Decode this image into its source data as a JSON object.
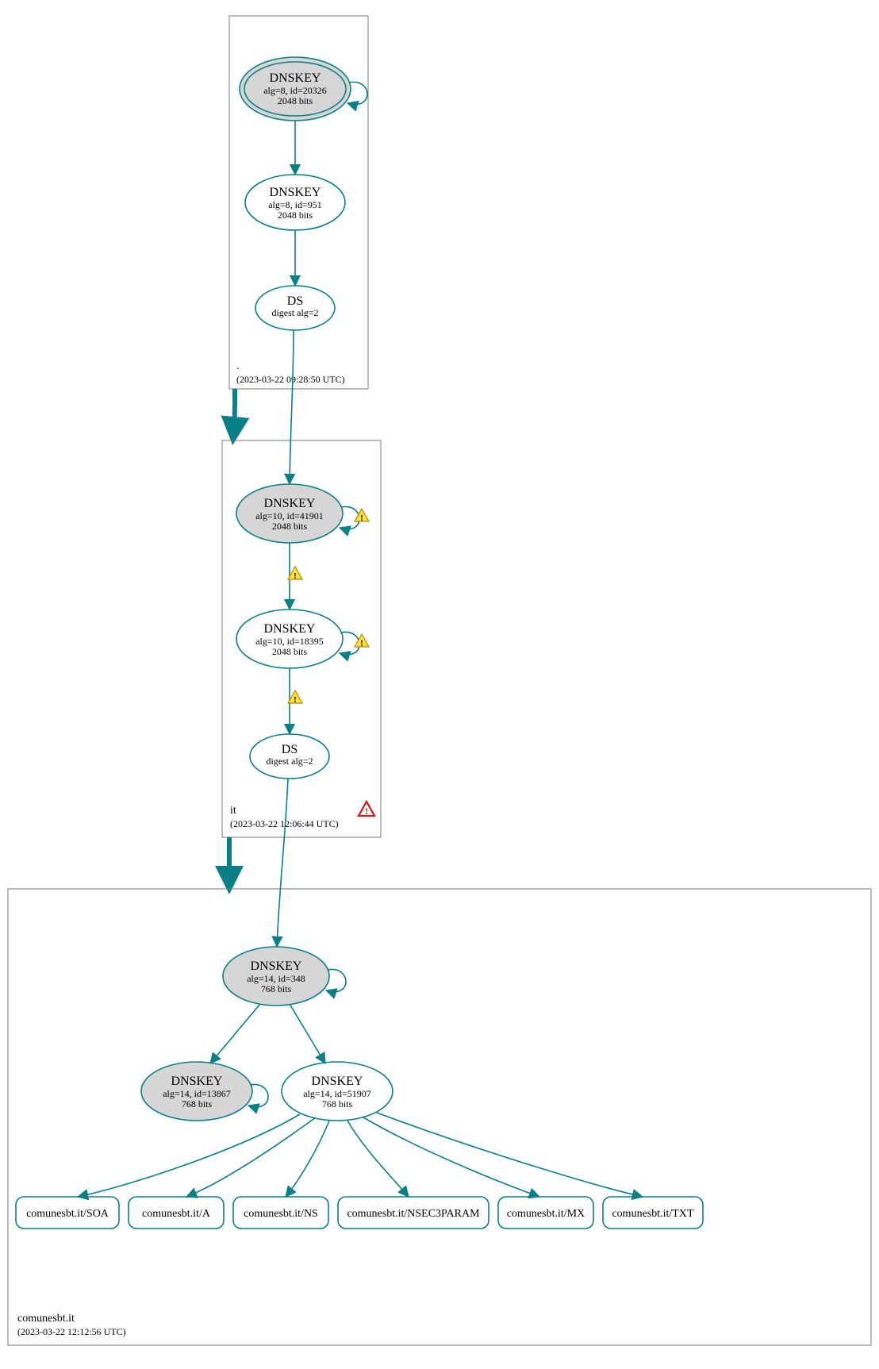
{
  "zones": {
    "root": {
      "label": ".",
      "timestamp": "(2023-03-22 09:28:50 UTC)",
      "ksk": {
        "title": "DNSKEY",
        "alg": "alg=8, id=20326",
        "bits": "2048 bits"
      },
      "zsk": {
        "title": "DNSKEY",
        "alg": "alg=8, id=951",
        "bits": "2048 bits"
      },
      "ds": {
        "title": "DS",
        "digest": "digest alg=2"
      }
    },
    "it": {
      "label": "it",
      "timestamp": "(2023-03-22 12:06:44 UTC)",
      "ksk": {
        "title": "DNSKEY",
        "alg": "alg=10, id=41901",
        "bits": "2048 bits"
      },
      "zsk": {
        "title": "DNSKEY",
        "alg": "alg=10, id=18395",
        "bits": "2048 bits"
      },
      "ds": {
        "title": "DS",
        "digest": "digest alg=2"
      }
    },
    "leaf": {
      "label": "comunesbt.it",
      "timestamp": "(2023-03-22 12:12:56 UTC)",
      "ksk": {
        "title": "DNSKEY",
        "alg": "alg=14, id=348",
        "bits": "768 bits"
      },
      "zsk2": {
        "title": "DNSKEY",
        "alg": "alg=14, id=13867",
        "bits": "768 bits"
      },
      "zsk": {
        "title": "DNSKEY",
        "alg": "alg=14, id=51907",
        "bits": "768 bits"
      },
      "rr": {
        "soa": "comunesbt.it/SOA",
        "a": "comunesbt.it/A",
        "ns": "comunesbt.it/NS",
        "nsec3": "comunesbt.it/NSEC3PARAM",
        "mx": "comunesbt.it/MX",
        "txt": "comunesbt.it/TXT"
      }
    }
  },
  "colors": {
    "stroke": "#0a7f86",
    "fill_grey": "#d6d6d6"
  }
}
